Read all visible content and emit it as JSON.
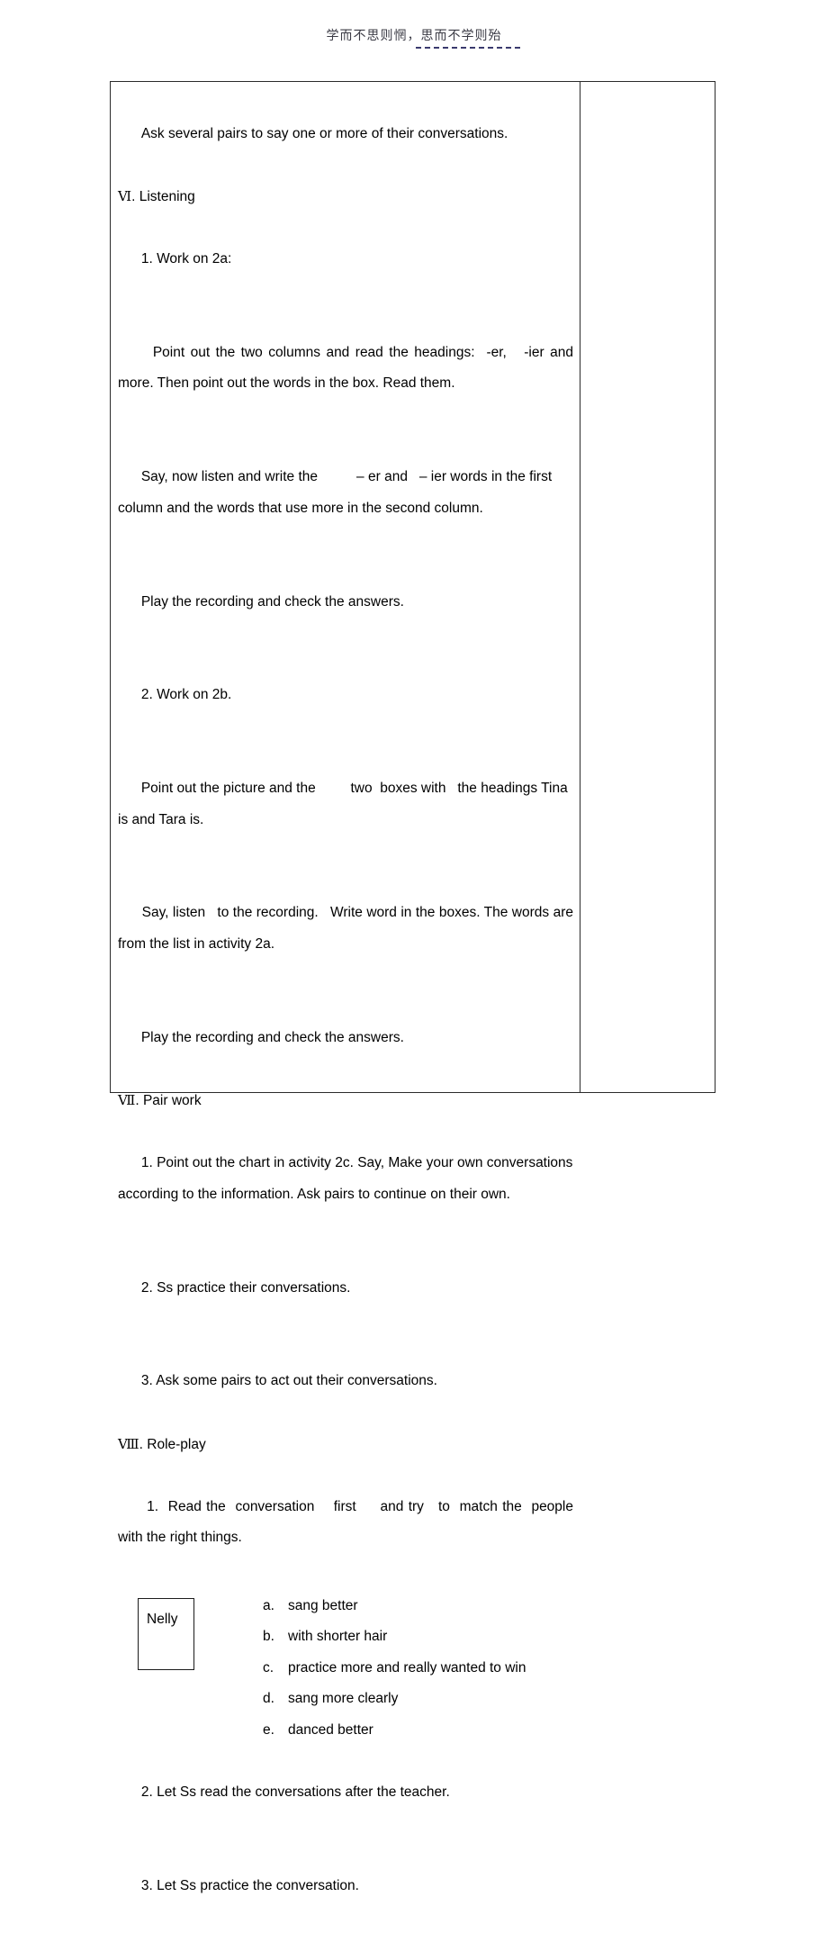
{
  "header": {
    "motto": "学而不思则惘，思而不学则殆"
  },
  "table": {
    "main_column": {
      "paragraphs": [
        {
          "id": "p-ask-pairs",
          "text": "Ask several pairs to say one or more of their conversations.",
          "align": "justify"
        },
        {
          "id": "p-section-listening",
          "roman": "Ⅵ",
          "text": ". Listening",
          "align": "left"
        },
        {
          "id": "p-work-2a",
          "text": "1. Work on 2a:",
          "align": "left"
        },
        {
          "id": "p-point-columns",
          "text": "Point out the two columns and read the headings:  -er,   -ier and more. Then point out the words in the box. Read them.",
          "align": "justify"
        },
        {
          "id": "p-say-listen-write",
          "text": "Say, now listen and write the          – er and   – ier words in the first column and the words that use more in the second column.",
          "align": "left"
        },
        {
          "id": "p-play-recording-1",
          "text": "Play the recording and check the answers.",
          "align": "left"
        },
        {
          "id": "p-work-2b",
          "text": "2. Work on 2b.",
          "align": "left"
        },
        {
          "id": "p-point-picture",
          "text": "Point out the picture and the         two  boxes with   the headings Tina is and Tara is.",
          "align": "left"
        },
        {
          "id": "p-say-listen-write-boxes",
          "text": "Say, listen   to the recording.   Write word in the boxes. The words are from the list in activity 2a.",
          "align": "justify"
        },
        {
          "id": "p-play-recording-2",
          "text": "Play the recording and check the answers.",
          "align": "left"
        },
        {
          "id": "p-section-pairwork",
          "roman": "Ⅶ",
          "text": ". Pair work",
          "align": "left"
        },
        {
          "id": "p-point-chart",
          "text": "1. Point out the chart in activity 2c. Say, Make your own conversations according to the information. Ask pairs to continue on their own.",
          "align": "left"
        },
        {
          "id": "p-ss-practice",
          "text": "2. Ss practice their conversations.",
          "align": "left"
        },
        {
          "id": "p-ask-pairs-act",
          "text": "3. Ask some pairs to act out their conversations.",
          "align": "left"
        },
        {
          "id": "p-section-roleplay",
          "roman": "Ⅷ",
          "text": ". Role-play",
          "align": "left"
        },
        {
          "id": "p-read-conversation",
          "text": "1.  Read the  conversation    first     and try   to  match the  people with the right things.",
          "align": "justify"
        }
      ],
      "roleplay": {
        "name_box_label": "Nelly",
        "match_items": [
          {
            "marker": "a.",
            "text": "sang better"
          },
          {
            "marker": "b.",
            "text": "with shorter hair"
          },
          {
            "marker": "c.",
            "text": "practice more and really wanted to win"
          },
          {
            "marker": "d.",
            "text": "sang more clearly"
          },
          {
            "marker": "e.",
            "text": "danced better"
          }
        ]
      },
      "closing_paragraphs": [
        {
          "id": "p-let-ss-read",
          "text": "2. Let Ss read the conversations after the teacher."
        },
        {
          "id": "p-let-ss-practice",
          "text": "3. Let Ss practice the conversation."
        }
      ]
    },
    "side_column": {
      "content": ""
    }
  }
}
